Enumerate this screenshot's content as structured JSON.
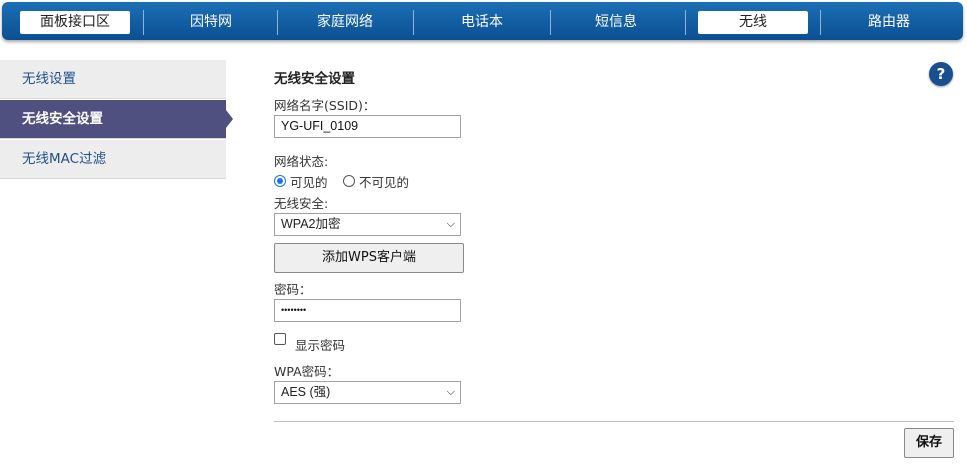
{
  "nav": {
    "tabs": [
      "面板接口区",
      "因特网",
      "家庭网络",
      "电话本",
      "短信息",
      "无线",
      "路由器"
    ],
    "active": [
      "面板接口区",
      "无线"
    ]
  },
  "sidebar": {
    "items": [
      {
        "label": "无线设置"
      },
      {
        "label": "无线安全设置"
      },
      {
        "label": "无线MAC过滤"
      }
    ],
    "active": "无线安全设置"
  },
  "help": {
    "label": "?"
  },
  "form": {
    "title": "无线安全设置",
    "ssid_label": "网络名字(SSID)：",
    "ssid_value": "YG-UFI_0109",
    "status_label": "网络状态:",
    "visible_label": "可见的",
    "invisible_label": "不可见的",
    "visible_selected": true,
    "security_label": "无线安全:",
    "security_value": "WPA2加密",
    "wps_button": "添加WPS客户端",
    "password_label": "密码：",
    "password_value": "••••••••",
    "show_password_label": "显示密码",
    "show_password_checked": false,
    "wpa_cipher_label": "WPA密码：",
    "wpa_cipher_value": "AES (强)"
  },
  "actions": {
    "save": "保存"
  },
  "colors": {
    "nav_bar": "#0b4f92",
    "sidebar_active": "#4f4f80",
    "sidebar_bg": "#ededed",
    "link_text": "#1f4e8a",
    "radio_accent": "#1a73e8"
  },
  "icons": {
    "help": "help-icon",
    "dropdown": "chevron-down-icon"
  }
}
